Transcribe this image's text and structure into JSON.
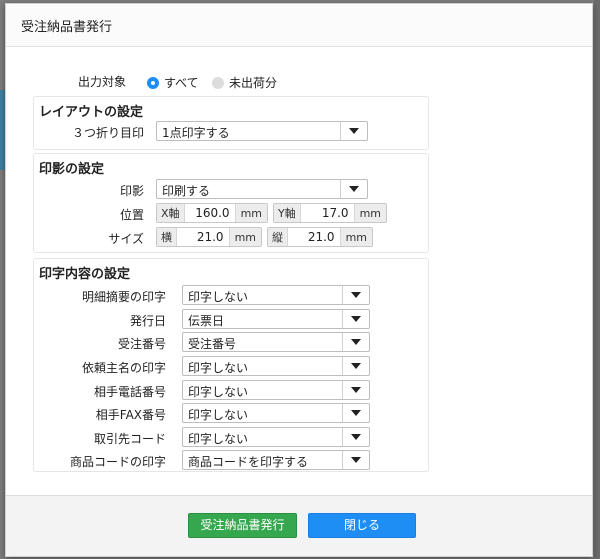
{
  "dialog": {
    "title": "受注納品書発行"
  },
  "output": {
    "label": "出力対象",
    "options": [
      {
        "label": "すべて",
        "selected": true
      },
      {
        "label": "未出荷分",
        "selected": false
      }
    ]
  },
  "layout": {
    "title": "レイアウトの設定",
    "fold_label": "３つ折り目印",
    "fold_value": "1点印字する"
  },
  "stamp": {
    "title": "印影の設定",
    "stamp_label": "印影",
    "stamp_value": "印刷する",
    "position_label": "位置",
    "x_prefix": "X軸",
    "x_value": "160.0",
    "y_prefix": "Y軸",
    "y_value": "17.0",
    "size_label": "サイズ",
    "w_prefix": "横",
    "w_value": "21.0",
    "h_prefix": "縦",
    "h_value": "21.0",
    "unit": "mm"
  },
  "print": {
    "title": "印字内容の設定",
    "rows": [
      {
        "label": "明細摘要の印字",
        "value": "印字しない"
      },
      {
        "label": "発行日",
        "value": "伝票日"
      },
      {
        "label": "受注番号",
        "value": "受注番号"
      },
      {
        "label": "依頼主名の印字",
        "value": "印字しない"
      },
      {
        "label": "相手電話番号",
        "value": "印字しない"
      },
      {
        "label": "相手FAX番号",
        "value": "印字しない"
      },
      {
        "label": "取引先コード",
        "value": "印字しない"
      },
      {
        "label": "商品コードの印字",
        "value": "商品コードを印字する"
      }
    ]
  },
  "footer": {
    "issue_label": "受注納品書発行",
    "close_label": "閉じる"
  }
}
